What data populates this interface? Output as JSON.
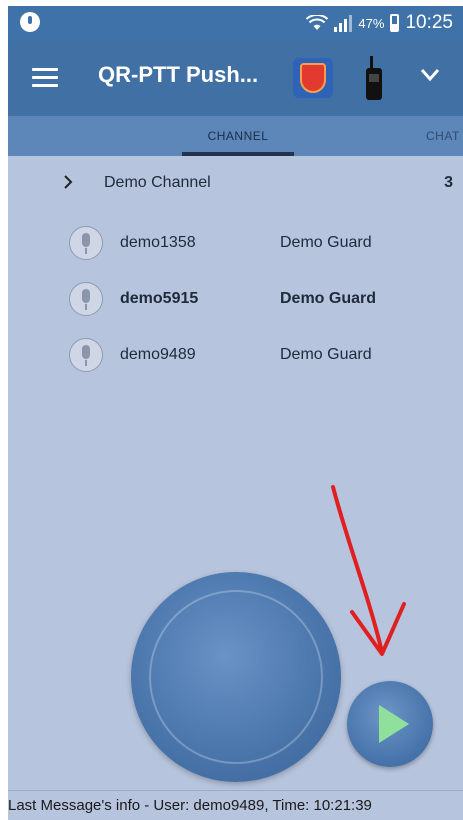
{
  "status_bar": {
    "battery_percent": "47%",
    "time": "10:25"
  },
  "app_bar": {
    "title": "QR-PTT Push..."
  },
  "tabs": [
    {
      "label": "CHANNEL",
      "selected": true
    },
    {
      "label": "CHAT",
      "selected": false
    }
  ],
  "channel": {
    "name": "Demo Channel",
    "count": "3",
    "members": [
      {
        "name": "demo1358",
        "role": "Demo Guard",
        "bold": false
      },
      {
        "name": "demo5915",
        "role": "Demo Guard",
        "bold": true
      },
      {
        "name": "demo9489",
        "role": "Demo Guard",
        "bold": false
      }
    ]
  },
  "footer": {
    "last_message": "Last Message's info - User: demo9489, Time: 10:21:39"
  },
  "colors": {
    "status_bar": "#3f72a8",
    "app_bar": "#4170a4",
    "tab_bar": "#5d86b9",
    "background": "#b7c4dd",
    "play_icon": "#8fe09a",
    "annotation_arrow": "#e02020"
  },
  "icons": {
    "status_left": "notification-icon",
    "menu": "menu-icon",
    "badge": "shield-badge-icon",
    "radio": "walkie-talkie-icon",
    "chevron": "chevron-down-icon",
    "expand": "chevron-right-icon",
    "member": "microphone-icon",
    "play": "play-icon"
  }
}
